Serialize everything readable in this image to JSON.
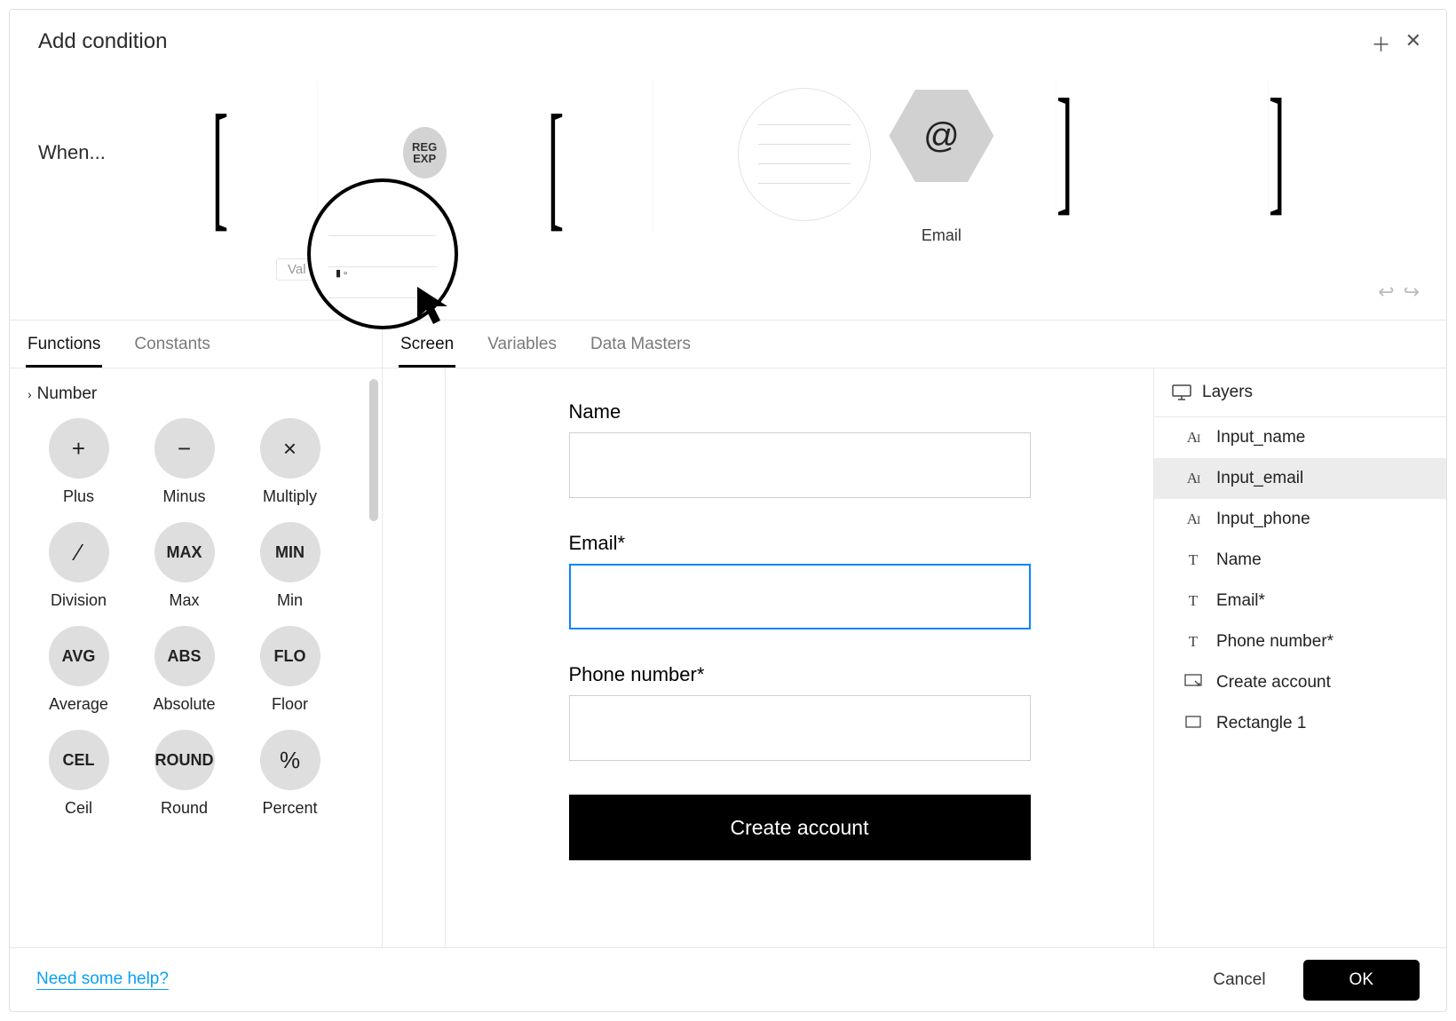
{
  "header": {
    "title": "Add condition",
    "when": "When...",
    "regexp": "REG\nEXP",
    "value_tag": "Val",
    "hexagon_label": "Email",
    "at_symbol": "@"
  },
  "tabs_left": [
    {
      "label": "Functions",
      "active": true
    },
    {
      "label": "Constants",
      "active": false
    }
  ],
  "tabs_center": [
    {
      "label": "Screen",
      "active": true
    },
    {
      "label": "Variables",
      "active": false
    },
    {
      "label": "Data Masters",
      "active": false
    }
  ],
  "functions": {
    "section": "Number",
    "items": [
      {
        "icon": "+",
        "label": "Plus",
        "big": true
      },
      {
        "icon": "−",
        "label": "Minus",
        "big": true
      },
      {
        "icon": "×",
        "label": "Multiply",
        "big": true
      },
      {
        "icon": "⁄",
        "label": "Division",
        "big": true
      },
      {
        "icon": "MAX",
        "label": "Max",
        "big": false
      },
      {
        "icon": "MIN",
        "label": "Min",
        "big": false
      },
      {
        "icon": "AVG",
        "label": "Average",
        "big": false
      },
      {
        "icon": "ABS",
        "label": "Absolute",
        "big": false
      },
      {
        "icon": "FLO",
        "label": "Floor",
        "big": false
      },
      {
        "icon": "CEL",
        "label": "Ceil",
        "big": false
      },
      {
        "icon": "ROUND",
        "label": "Round",
        "big": false
      },
      {
        "icon": "%",
        "label": "Percent",
        "big": true
      }
    ]
  },
  "preview": {
    "fields": [
      {
        "label": "Name",
        "focused": false
      },
      {
        "label": "Email*",
        "focused": true
      },
      {
        "label": "Phone number*",
        "focused": false
      }
    ],
    "button": "Create account"
  },
  "layers": {
    "header": "Layers",
    "items": [
      {
        "icon": "AI",
        "label": "Input_name",
        "selected": false
      },
      {
        "icon": "AI",
        "label": "Input_email",
        "selected": true
      },
      {
        "icon": "AI",
        "label": "Input_phone",
        "selected": false
      },
      {
        "icon": "T",
        "label": "Name",
        "selected": false
      },
      {
        "icon": "T",
        "label": "Email*",
        "selected": false
      },
      {
        "icon": "T",
        "label": "Phone number*",
        "selected": false
      },
      {
        "icon": "btn",
        "label": "Create account",
        "selected": false
      },
      {
        "icon": "rect",
        "label": "Rectangle 1",
        "selected": false
      }
    ]
  },
  "footer": {
    "help": "Need some help?",
    "cancel": "Cancel",
    "ok": "OK"
  }
}
